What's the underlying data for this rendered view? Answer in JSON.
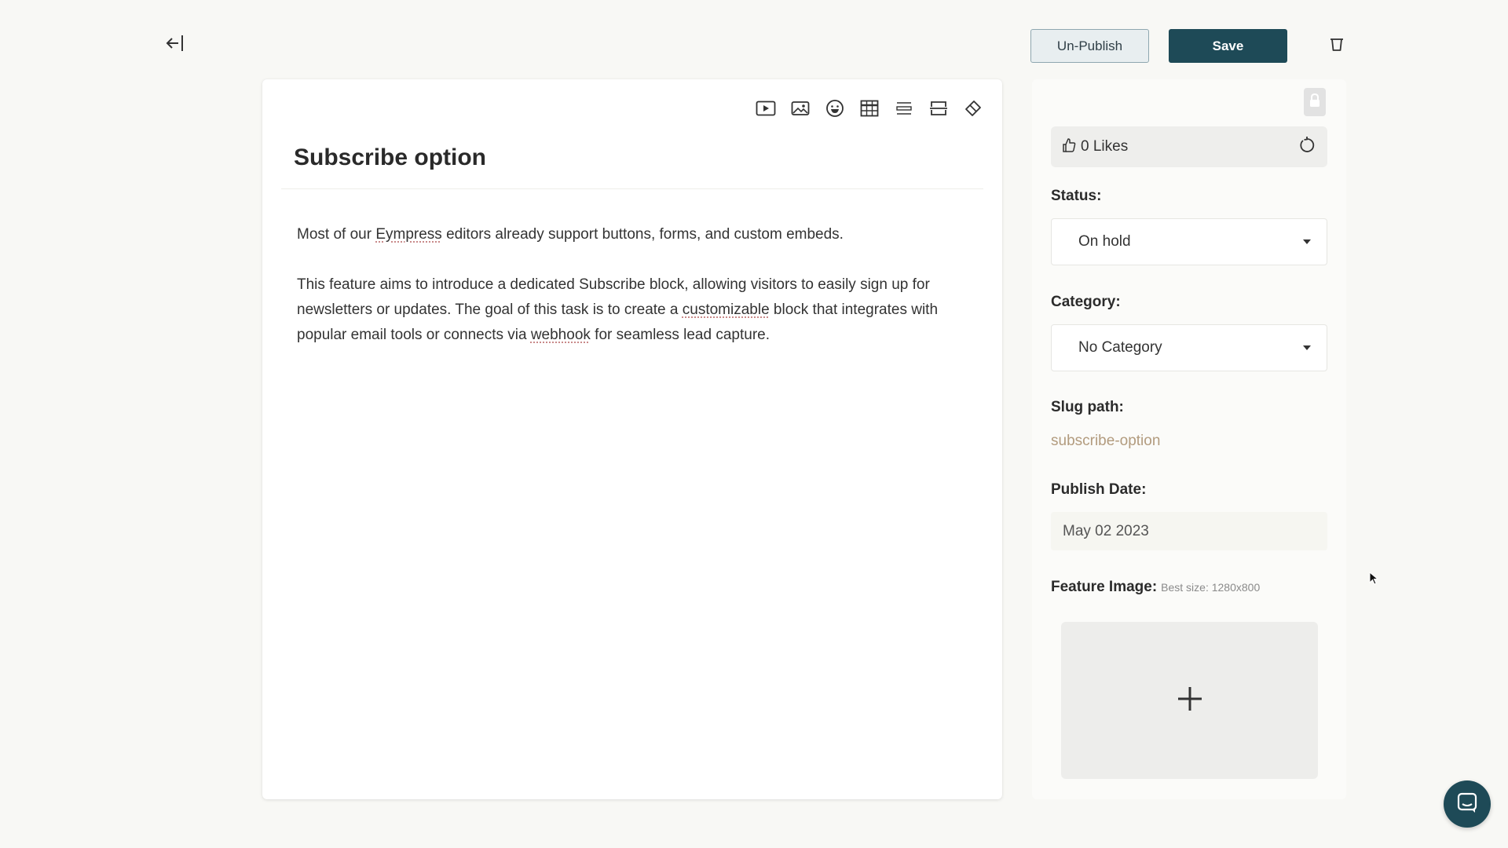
{
  "header": {
    "back_icon": "collapse-left-arrow-icon",
    "unpublish_label": "Un-Publish",
    "save_label": "Save",
    "trash_icon": "trash-icon"
  },
  "toolbar": {
    "icons": [
      "video-icon",
      "image-icon",
      "emoji-icon",
      "table-icon",
      "divider-icon",
      "page-break-icon",
      "eraser-icon"
    ]
  },
  "post": {
    "title": "Subscribe option",
    "paragraphs": [
      [
        {
          "text": "Most of our "
        },
        {
          "text": "Eympress",
          "flag": true
        },
        {
          "text": " editors already support buttons, forms, and custom embeds."
        }
      ],
      [
        {
          "text": "This feature aims to introduce a dedicated Subscribe block, allowing visitors to easily sign up for newsletters or updates. The goal of this task is to create a "
        },
        {
          "text": "customizable",
          "flag": true
        },
        {
          "text": " block that integrates with popular email tools or connects via "
        },
        {
          "text": "webhook",
          "flag": true
        },
        {
          "text": " for seamless lead capture."
        }
      ]
    ]
  },
  "sidebar": {
    "likes_label": "0 Likes",
    "status_label": "Status:",
    "status_value": "On hold",
    "category_label": "Category:",
    "category_value": "No Category",
    "slug_label": "Slug path:",
    "slug_value": "subscribe-option",
    "publish_date_label": "Publish Date:",
    "publish_date_value": "May 02 2023",
    "feature_image_label": "Feature Image:",
    "feature_image_hint": "Best size: 1280x800"
  },
  "colors": {
    "background": "#f8f8f5",
    "primary": "#1e4a57",
    "slug": "#b29b7e"
  }
}
